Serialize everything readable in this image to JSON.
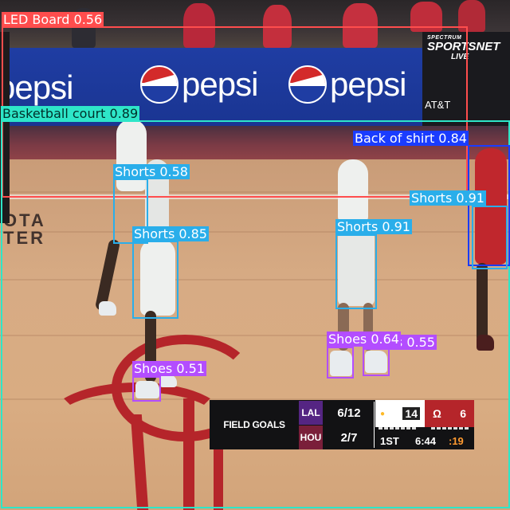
{
  "scene": {
    "sponsor_text": "pepsi",
    "broadcaster": {
      "small": "SPECTRUM",
      "big": "SPORTSNET",
      "live": "LIVE"
    },
    "sponsor_att": "AT&T",
    "arena_text_1": "OTA",
    "arena_text_2": "TER"
  },
  "scoreboard": {
    "label": "FIELD GOALS",
    "teams": [
      {
        "abbr": "LAL",
        "field_goals": "6/12",
        "color": "#552583"
      },
      {
        "abbr": "HOU",
        "field_goals": "2/7",
        "color": "#7a1f3a"
      }
    ],
    "home_score": "14",
    "away_score": "6",
    "quarter": "1ST",
    "clock": "6:44",
    "shot_clock": ":19"
  },
  "detections": [
    {
      "label": "LED Board",
      "score": "0.56",
      "text": "LED Board 0.56",
      "color": "#ff4d4d",
      "text_color": "#ffffff"
    },
    {
      "label": "Basketball court",
      "score": "0.89",
      "text": "Basketball court 0.89",
      "color": "#2ee6c8",
      "text_color": "#00302a"
    },
    {
      "label": "Back of shirt",
      "score": "0.84",
      "text": "Back of shirt 0.84",
      "color": "#1a3cff",
      "text_color": "#ffffff"
    },
    {
      "label": "Shorts",
      "score": "0.58",
      "text": "Shorts 0.58",
      "color": "#2aaeea",
      "text_color": "#ffffff"
    },
    {
      "label": "Shorts",
      "score": "0.85",
      "text": "Shorts 0.85",
      "color": "#2aaeea",
      "text_color": "#ffffff"
    },
    {
      "label": "Shorts",
      "score": "0.91",
      "text": "Shorts 0.91",
      "color": "#2aaeea",
      "text_color": "#ffffff"
    },
    {
      "label": "Shorts",
      "score": "0.91",
      "text": "Shorts 0.91",
      "color": "#2aaeea",
      "text_color": "#ffffff"
    },
    {
      "label": "Shoes",
      "score": "0.64",
      "text": "Shoes 0.64",
      "color": "#b34dff",
      "text_color": "#ffffff"
    },
    {
      "label": "Shoes",
      "score": "0.55",
      "text": "Shoes 0.55",
      "color": "#b34dff",
      "text_color": "#ffffff"
    },
    {
      "label": "Shoes",
      "score": "0.51",
      "text": "Shoes 0.51",
      "color": "#b34dff",
      "text_color": "#ffffff"
    }
  ]
}
